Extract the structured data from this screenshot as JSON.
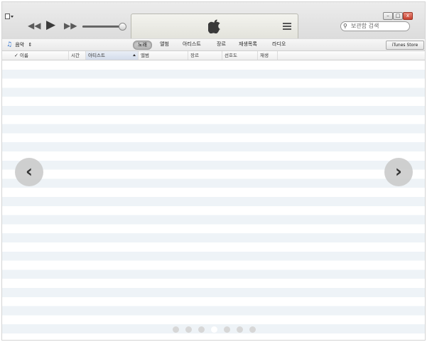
{
  "toolbar": {
    "prev_icon": "rewind-icon",
    "play_icon": "play-icon",
    "next_icon": "fast-forward-icon",
    "volume_level": 0.9,
    "search_placeholder": "보관함 검색"
  },
  "window_controls": {
    "minimize": "–",
    "maximize": "□",
    "close": "x"
  },
  "nav": {
    "library_label": "음악",
    "library_arrows": "⇕",
    "tabs": [
      "노래",
      "앨범",
      "아티스트",
      "장르",
      "재생목록",
      "라디오"
    ],
    "selected_tab": 0,
    "store_label": "iTunes Store"
  },
  "columns": [
    {
      "label": "이름",
      "checked": true
    },
    {
      "label": "시간"
    },
    {
      "label": "아티스트",
      "sorted": true
    },
    {
      "label": "앨범"
    },
    {
      "label": "장르"
    },
    {
      "label": "선호도"
    },
    {
      "label": "재생"
    }
  ],
  "carousel": {
    "left_glyph": "‹",
    "right_glyph": "›",
    "dot_count": 7,
    "active_dot": 3
  },
  "colors": {
    "accent": "#2a6fd0",
    "row_stripe": "#eef3f7"
  }
}
